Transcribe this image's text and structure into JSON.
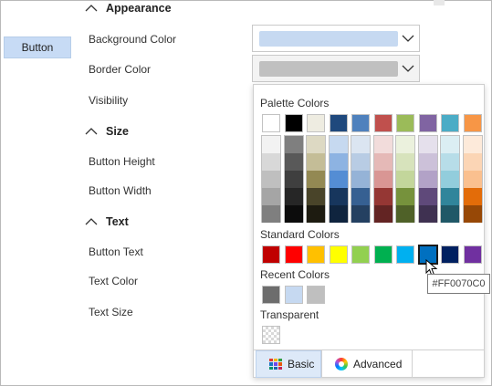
{
  "sidebar": {
    "button_label": "Button"
  },
  "sections": {
    "appearance": "Appearance",
    "size": "Size",
    "text": "Text"
  },
  "properties": {
    "background_color": "Background Color",
    "border_color": "Border Color",
    "visibility": "Visibility",
    "button_height": "Button Height",
    "button_width": "Button Width",
    "button_text": "Button Text",
    "text_color": "Text Color",
    "text_size": "Text Size"
  },
  "combos": {
    "background_color_value": "#C6D9F1",
    "border_color_value": "#C0C0C0"
  },
  "color_picker": {
    "palette_label": "Palette Colors",
    "standard_label": "Standard Colors",
    "recent_label": "Recent Colors",
    "transparent_label": "Transparent",
    "palette_top": [
      "#FFFFFF",
      "#000000",
      "#EEECE1",
      "#1F497D",
      "#4F81BD",
      "#C0504D",
      "#9BBB59",
      "#8064A2",
      "#4BACC6",
      "#F79646"
    ],
    "palette_shades": [
      [
        "#F2F2F2",
        "#D8D8D8",
        "#BFBFBF",
        "#A5A5A5",
        "#7F7F7F"
      ],
      [
        "#7F7F7F",
        "#595959",
        "#3F3F3F",
        "#262626",
        "#0C0C0C"
      ],
      [
        "#DDD9C3",
        "#C4BD97",
        "#938953",
        "#494429",
        "#1D1B10"
      ],
      [
        "#C6D9F0",
        "#8DB3E2",
        "#548DD4",
        "#17365D",
        "#0F243E"
      ],
      [
        "#DBE5F1",
        "#B8CCE4",
        "#95B3D7",
        "#366092",
        "#244061"
      ],
      [
        "#F2DCDB",
        "#E5B9B7",
        "#D99694",
        "#953734",
        "#632423"
      ],
      [
        "#EBF1DD",
        "#D7E3BC",
        "#C3D69B",
        "#76923C",
        "#4F6128"
      ],
      [
        "#E5E0EC",
        "#CCC1D9",
        "#B2A2C7",
        "#5F497A",
        "#3F3151"
      ],
      [
        "#DBEEF3",
        "#B7DDE8",
        "#92CDDC",
        "#31859B",
        "#205867"
      ],
      [
        "#FDEADA",
        "#FBD5B5",
        "#FAC08F",
        "#E36C09",
        "#974806"
      ]
    ],
    "standard": [
      "#C00000",
      "#FF0000",
      "#FFC000",
      "#FFFF00",
      "#92D050",
      "#00B050",
      "#00B0F0",
      "#0070C0",
      "#002060",
      "#7030A0"
    ],
    "selected_standard_index": 7,
    "recent": [
      "#6D6D6D",
      "#C6D9F1",
      "#BFBFBF"
    ],
    "tabs": {
      "basic": "Basic",
      "advanced": "Advanced"
    }
  },
  "tooltip": "#FF0070C0",
  "icons": {
    "section_chevron": "chevron-up-icon",
    "combo_arrow": "chevron-down-icon",
    "basic_tab": "palette-grid-icon",
    "advanced_tab": "color-wheel-icon"
  }
}
